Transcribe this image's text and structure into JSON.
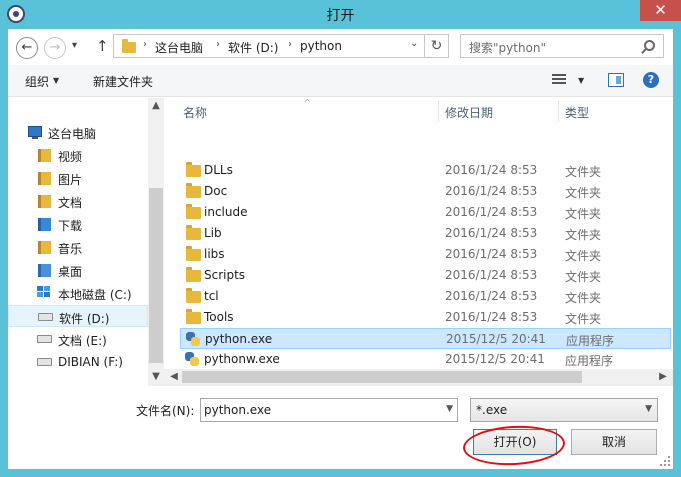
{
  "window": {
    "title": "打开",
    "close_glyph": "✕"
  },
  "address_bar": {
    "back_glyph": "←",
    "forward_glyph": "→",
    "recent_glyph": "▾",
    "up_glyph": "↑",
    "separator_glyph": "›",
    "breadcrumb": [
      "这台电脑",
      "软件 (D:)",
      "python"
    ],
    "dropdown_glyph": "⌄",
    "refresh_glyph": "↻"
  },
  "search": {
    "placeholder": "搜索\"python\""
  },
  "toolbar": {
    "organize_label": "组织",
    "new_folder_label": "新建文件夹",
    "caret_glyph": "▼",
    "help_glyph": "?"
  },
  "nav_pane": {
    "up_arrow": "▲",
    "down_arrow": "▼",
    "items": [
      {
        "label": "这台电脑",
        "icon": "computer-icon"
      },
      {
        "label": "视频",
        "icon": "videos-library-icon"
      },
      {
        "label": "图片",
        "icon": "pictures-library-icon"
      },
      {
        "label": "文档",
        "icon": "documents-library-icon"
      },
      {
        "label": "下载",
        "icon": "downloads-icon"
      },
      {
        "label": "音乐",
        "icon": "music-library-icon"
      },
      {
        "label": "桌面",
        "icon": "desktop-icon"
      },
      {
        "label": "本地磁盘 (C:)",
        "icon": "system-drive-icon"
      },
      {
        "label": "软件 (D:)",
        "icon": "drive-icon",
        "selected": true
      },
      {
        "label": "文档 (E:)",
        "icon": "drive-icon"
      },
      {
        "label": "DIBIAN (F:)",
        "icon": "drive-icon"
      }
    ]
  },
  "file_list": {
    "sort_glyph": "^",
    "columns": [
      "名称",
      "修改日期",
      "类型"
    ],
    "rows": [
      {
        "name": "DLLs",
        "date": "2016/1/24 8:53",
        "type": "文件夹",
        "icon": "folder-icon"
      },
      {
        "name": "Doc",
        "date": "2016/1/24 8:53",
        "type": "文件夹",
        "icon": "folder-icon"
      },
      {
        "name": "include",
        "date": "2016/1/24 8:53",
        "type": "文件夹",
        "icon": "folder-icon"
      },
      {
        "name": "Lib",
        "date": "2016/1/24 8:53",
        "type": "文件夹",
        "icon": "folder-icon"
      },
      {
        "name": "libs",
        "date": "2016/1/24 8:53",
        "type": "文件夹",
        "icon": "folder-icon"
      },
      {
        "name": "Scripts",
        "date": "2016/1/24 8:53",
        "type": "文件夹",
        "icon": "folder-icon"
      },
      {
        "name": "tcl",
        "date": "2016/1/24 8:53",
        "type": "文件夹",
        "icon": "folder-icon"
      },
      {
        "name": "Tools",
        "date": "2016/1/24 8:53",
        "type": "文件夹",
        "icon": "folder-icon"
      },
      {
        "name": "python.exe",
        "date": "2015/12/5 20:41",
        "type": "应用程序",
        "icon": "python-icon",
        "selected": true
      },
      {
        "name": "pythonw.exe",
        "date": "2015/12/5 20:41",
        "type": "应用程序",
        "icon": "python-icon"
      }
    ],
    "left_arrow": "◀",
    "right_arrow": "▶"
  },
  "footer": {
    "filename_label": "文件名(N):",
    "filename_value": "python.exe",
    "filetype_value": "*.exe",
    "dropdown_glyph": "▼",
    "open_label": "打开(O)",
    "cancel_label": "取消"
  },
  "colors": {
    "titlebar": "#5ac2d8",
    "close_button": "#c7504b",
    "folder": "#e8b83c",
    "selection": "#cce8ff",
    "annotation_circle": "#e01010",
    "python_blue": "#3a72b0",
    "python_yellow": "#f2c94c"
  }
}
